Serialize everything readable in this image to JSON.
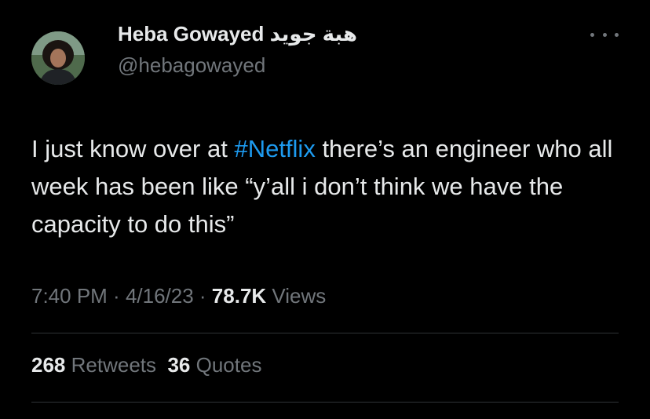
{
  "author": {
    "display_name": "Heba Gowayed هبة جويد",
    "handle": "@hebagowayed"
  },
  "tweet": {
    "text_before": "I just know over at ",
    "hashtag": "#Netflix",
    "text_after": " there’s an engineer who all week has been like “y’all i don’t think we have the capacity to do this”"
  },
  "meta": {
    "time": "7:40 PM",
    "sep1": " · ",
    "date": "4/16/23",
    "sep2": " · ",
    "views_count": "78.7K",
    "views_label": " Views"
  },
  "stats": {
    "retweets_count": "268",
    "retweets_label": "Retweets",
    "quotes_count": "36",
    "quotes_label": "Quotes"
  },
  "icons": {
    "more": "more-horizontal-icon"
  },
  "colors": {
    "background": "#000000",
    "text": "#e7e9ea",
    "muted": "#71767b",
    "link": "#1d9bf0",
    "divider": "#2f3336"
  }
}
